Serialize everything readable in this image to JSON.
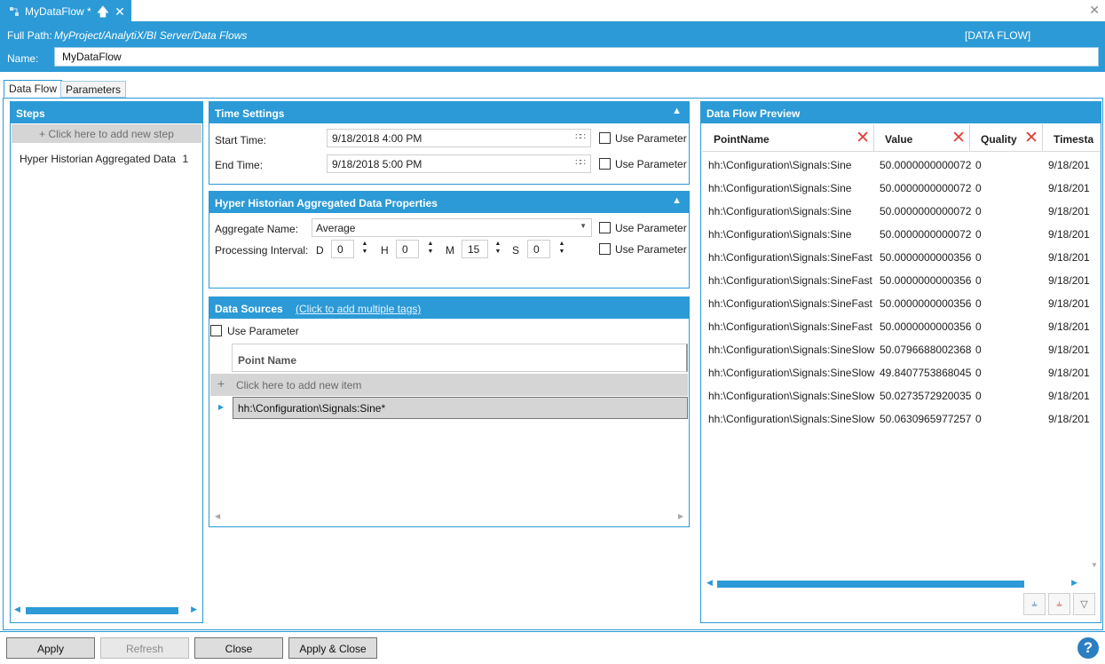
{
  "tab": {
    "title": "MyDataFlow *"
  },
  "header": {
    "full_path_label": "Full Path:",
    "full_path_value": "MyProject/AnalytiX/BI Server/Data Flows",
    "kind": "[DATA FLOW]",
    "name_label": "Name:",
    "name_value": "MyDataFlow"
  },
  "subtabs": [
    "Data Flow",
    "Parameters"
  ],
  "steps": {
    "title": "Steps",
    "add_step": "+ Click here to add new step",
    "items": [
      {
        "label": "Hyper Historian Aggregated Data",
        "count": "1"
      }
    ]
  },
  "time_settings": {
    "title": "Time Settings",
    "start_label": "Start Time:",
    "start_value": "9/18/2018 4:00 PM",
    "end_label": "End Time:",
    "end_value": "9/18/2018 5:00 PM",
    "use_parameter": "Use Parameter"
  },
  "agg_props": {
    "title": "Hyper Historian Aggregated Data Properties",
    "aggregate_label": "Aggregate Name:",
    "aggregate_value": "Average",
    "interval_label": "Processing Interval:",
    "d_label": "D",
    "d_value": "0",
    "h_label": "H",
    "h_value": "0",
    "m_label": "M",
    "m_value": "15",
    "s_label": "S",
    "s_value": "0",
    "use_parameter": "Use Parameter"
  },
  "data_sources": {
    "title": "Data Sources",
    "link": "(Click to add multiple tags)",
    "use_parameter": "Use Parameter",
    "column": "Point Name",
    "add_item": "Click here to add new item",
    "rows": [
      "hh:\\Configuration\\Signals:Sine*"
    ]
  },
  "preview": {
    "title": "Data Flow Preview",
    "columns": [
      "PointName",
      "Value",
      "Quality",
      "Timesta"
    ],
    "rows": [
      [
        "hh:\\Configuration\\Signals:Sine",
        "50.0000000000072",
        "0",
        "9/18/201"
      ],
      [
        "hh:\\Configuration\\Signals:Sine",
        "50.0000000000072",
        "0",
        "9/18/201"
      ],
      [
        "hh:\\Configuration\\Signals:Sine",
        "50.0000000000072",
        "0",
        "9/18/201"
      ],
      [
        "hh:\\Configuration\\Signals:Sine",
        "50.0000000000072",
        "0",
        "9/18/201"
      ],
      [
        "hh:\\Configuration\\Signals:SineFast",
        "50.0000000000356",
        "0",
        "9/18/201"
      ],
      [
        "hh:\\Configuration\\Signals:SineFast",
        "50.0000000000356",
        "0",
        "9/18/201"
      ],
      [
        "hh:\\Configuration\\Signals:SineFast",
        "50.0000000000356",
        "0",
        "9/18/201"
      ],
      [
        "hh:\\Configuration\\Signals:SineFast",
        "50.0000000000356",
        "0",
        "9/18/201"
      ],
      [
        "hh:\\Configuration\\Signals:SineSlow",
        "50.0796688002368",
        "0",
        "9/18/201"
      ],
      [
        "hh:\\Configuration\\Signals:SineSlow",
        "49.8407753868045",
        "0",
        "9/18/201"
      ],
      [
        "hh:\\Configuration\\Signals:SineSlow",
        "50.0273572920035",
        "0",
        "9/18/201"
      ],
      [
        "hh:\\Configuration\\Signals:SineSlow",
        "50.0630965977257",
        "0",
        "9/18/201"
      ]
    ]
  },
  "footer": {
    "apply": "Apply",
    "refresh": "Refresh",
    "close": "Close",
    "apply_close": "Apply & Close",
    "help": "?"
  },
  "colors": {
    "accent": "#2b9ad6",
    "remove": "#e0423a"
  }
}
